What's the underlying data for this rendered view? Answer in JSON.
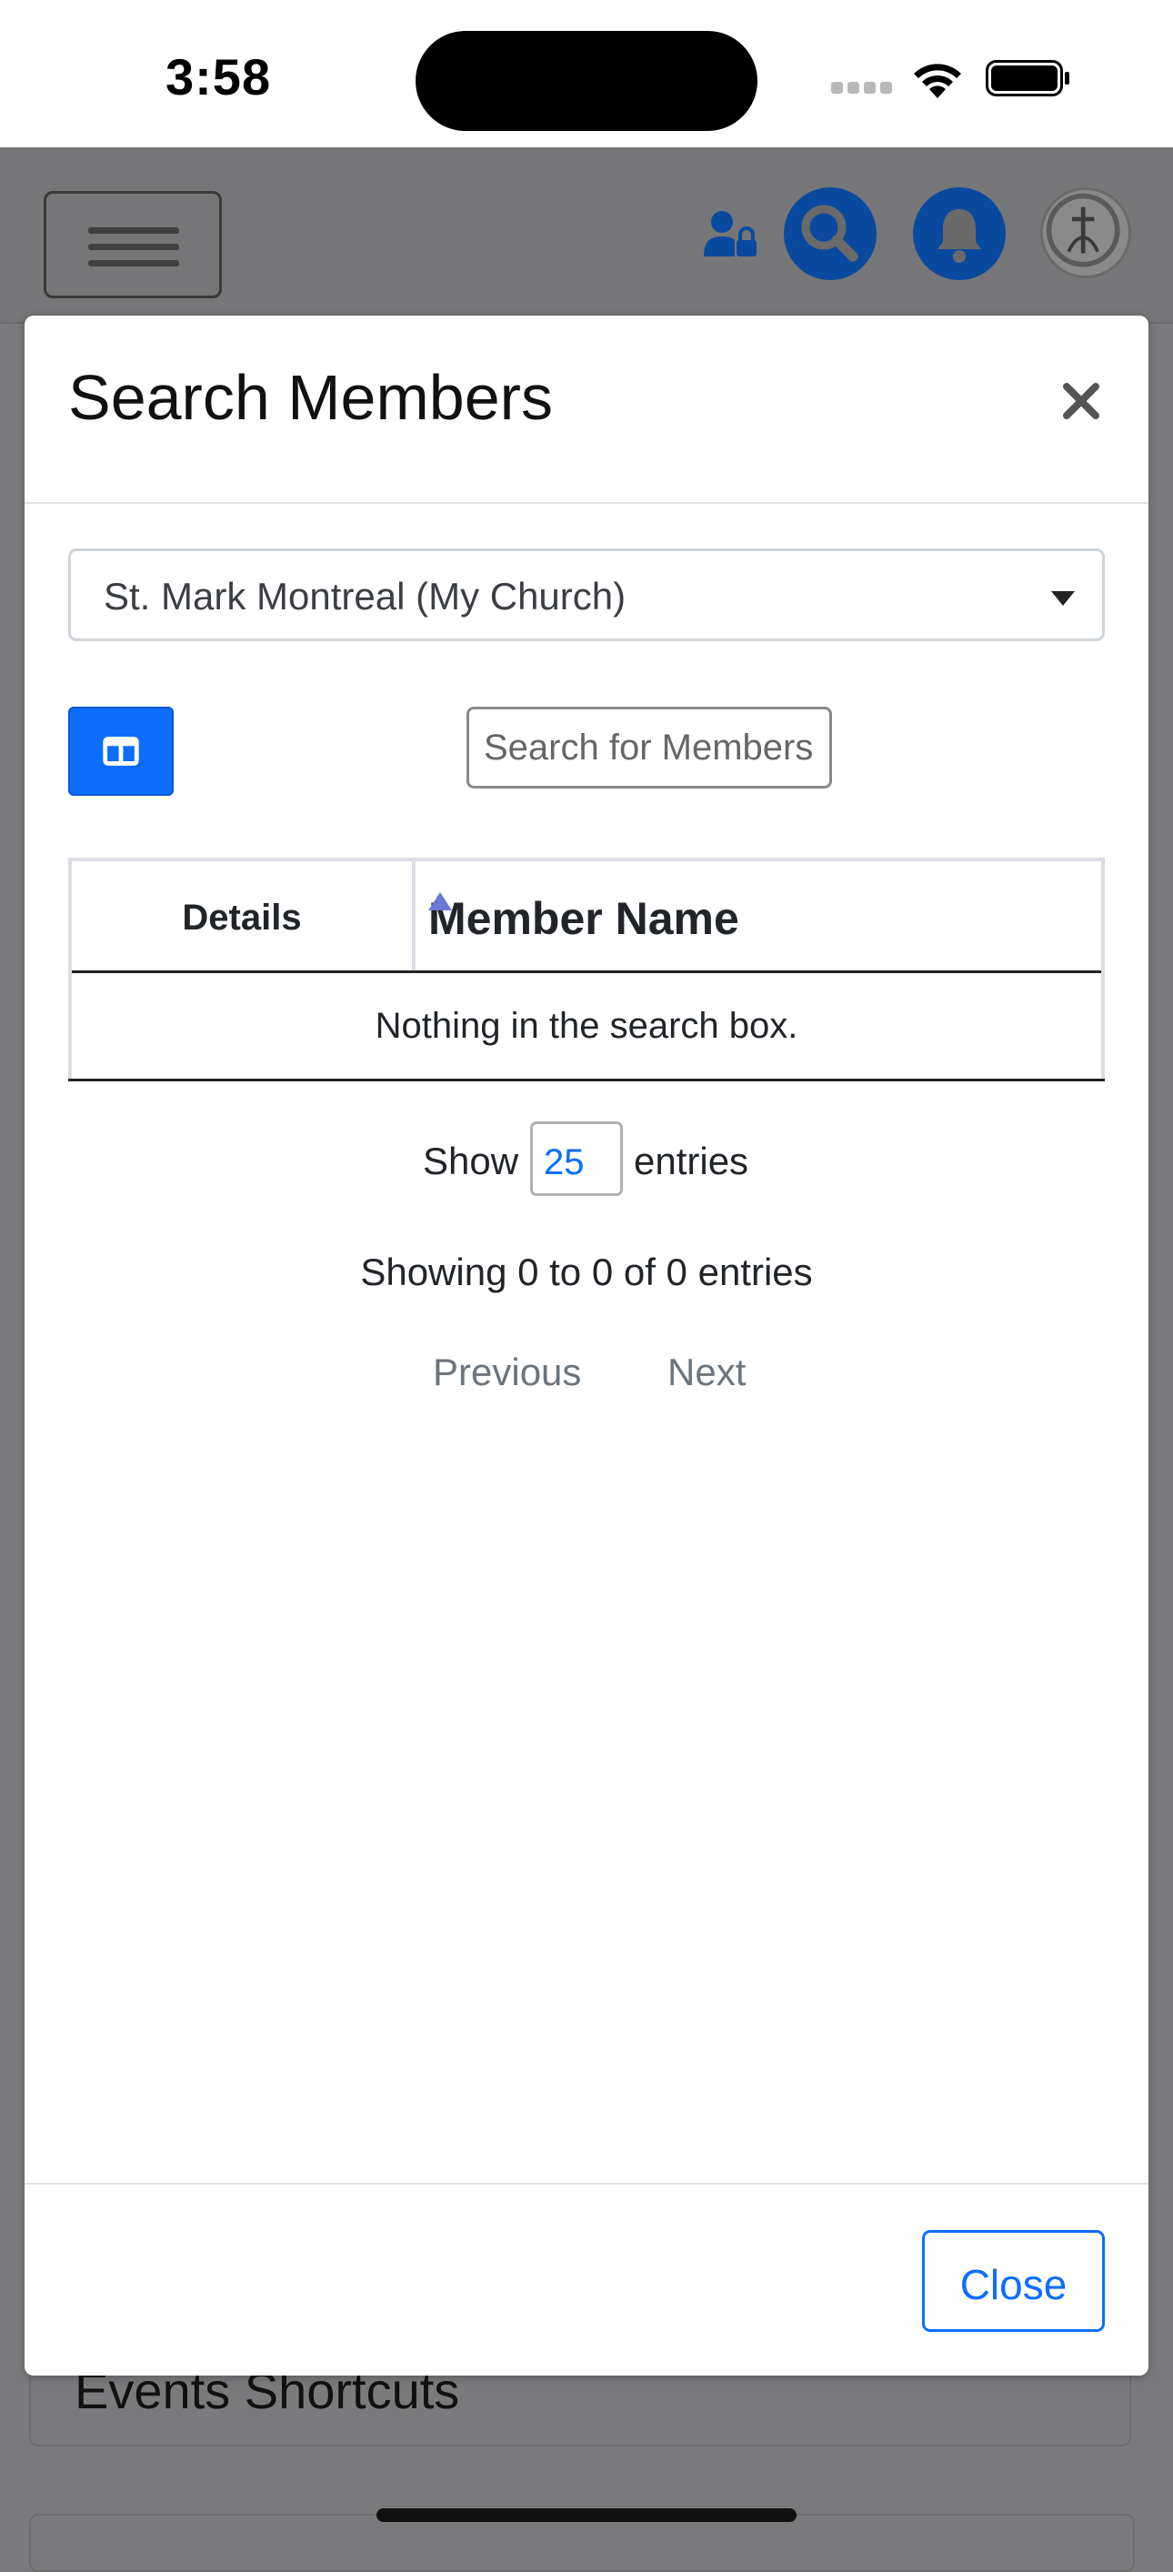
{
  "status_bar": {
    "time": "3:58"
  },
  "modal": {
    "title": "Search Members",
    "church_select": {
      "selected": "St. Mark Montreal (My Church)"
    },
    "search": {
      "placeholder": "Search for Members"
    },
    "table": {
      "columns": [
        "Details",
        "Member Name"
      ],
      "empty_message": "Nothing in the search box."
    },
    "page_length": {
      "prefix": "Show",
      "value": "25",
      "suffix": "entries"
    },
    "info": "Showing 0 to 0 of 0 entries",
    "pagination": {
      "previous": "Previous",
      "next": "Next"
    },
    "footer": {
      "close_label": "Close"
    }
  },
  "background_page": {
    "card_title": "Events Shortcuts"
  },
  "colors": {
    "primary": "#0d6efd",
    "overlay": "#7a7a7c",
    "header_icon_blue": "#0a4a9e"
  },
  "icons": [
    "hamburger-icon",
    "user-lock-icon",
    "search-icon",
    "bell-icon",
    "church-logo",
    "close-icon",
    "columns-icon",
    "sort-asc-icon"
  ]
}
